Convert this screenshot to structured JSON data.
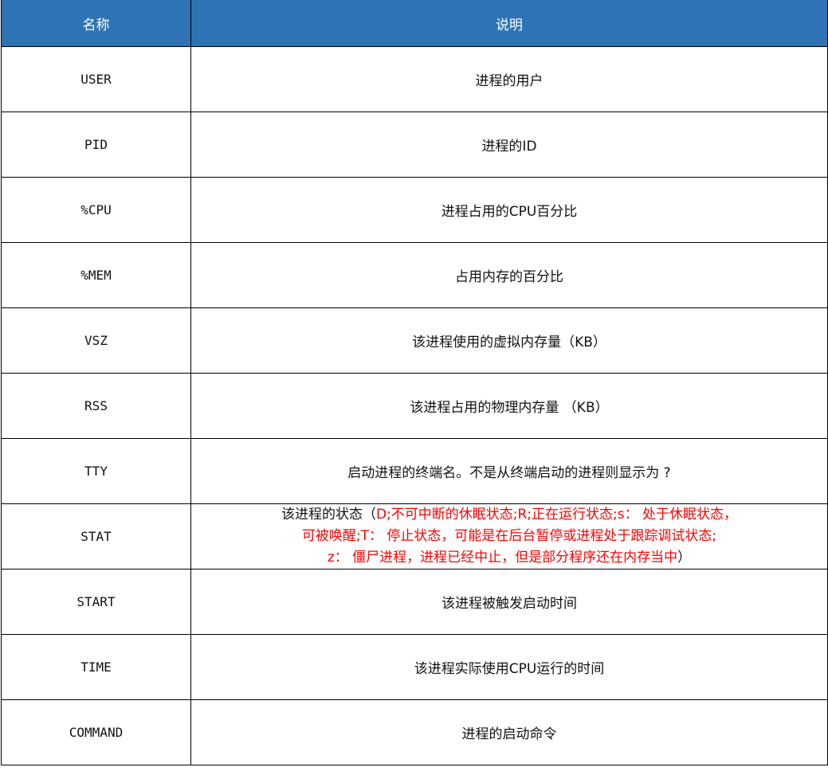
{
  "header": {
    "name": "名称",
    "description": "说明"
  },
  "rows": [
    {
      "name": "USER",
      "description": "进程的用户"
    },
    {
      "name": "PID",
      "description": "进程的ID"
    },
    {
      "name": "%CPU",
      "description": "进程占用的CPU百分比"
    },
    {
      "name": "%MEM",
      "description": "占用内存的百分比"
    },
    {
      "name": "VSZ",
      "description": "该进程使用的虚拟内存量（KB）"
    },
    {
      "name": "RSS",
      "description": "该进程占用的物理内存量 （KB）"
    },
    {
      "name": "TTY",
      "description": "启动进程的终端名。不是从终端启动的进程则显示为 ?"
    },
    {
      "name": "STAT",
      "description_prefix": "该进程的状态（",
      "description_line1_red": "D;不可中断的休眠状态;R;正在运行状态;s： 处于休眠状态，",
      "description_line2": "可被唤醒;T： 停止状态，可能是在后台暂停或进程处于跟踪调试状态;",
      "description_line3_red": "z： 僵尸进程，进程已经中止，但是部分程序还在内存当中",
      "description_suffix": "）"
    },
    {
      "name": "START",
      "description": "该进程被触发启动时间"
    },
    {
      "name": "TIME",
      "description": "该进程实际使用CPU运行的时间"
    },
    {
      "name": "COMMAND",
      "description": "进程的启动命令"
    }
  ],
  "colors": {
    "header_bg": "#2e74b5",
    "header_text": "#ffffff",
    "highlight_text": "#ff0000",
    "border": "#000000"
  }
}
